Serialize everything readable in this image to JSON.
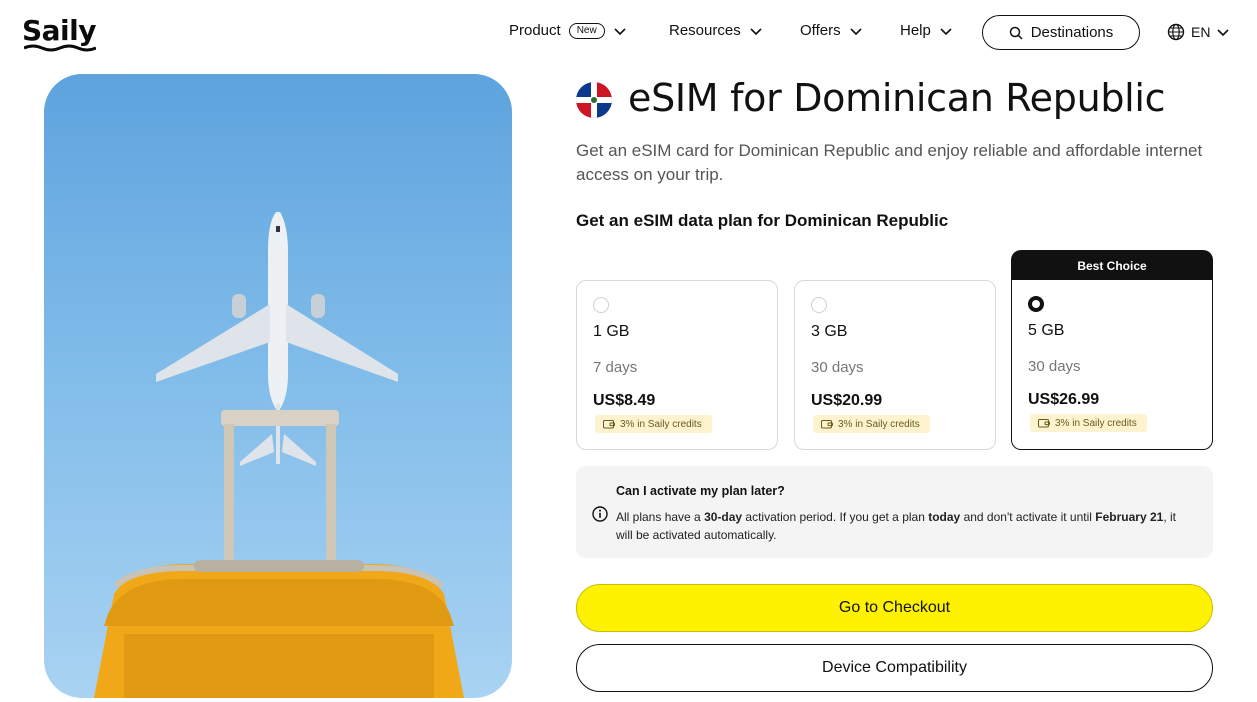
{
  "brand": {
    "logo_text": "Saily"
  },
  "nav": {
    "product": "Product",
    "product_badge": "New",
    "resources": "Resources",
    "offers": "Offers",
    "help": "Help",
    "destinations": "Destinations",
    "language": "EN"
  },
  "page": {
    "title": "eSIM for Dominican Republic",
    "subtitle": "Get an eSIM card for Dominican Republic and enjoy reliable and affordable internet access on your trip.",
    "plan_heading": "Get an eSIM data plan for Dominican Republic"
  },
  "plans": [
    {
      "data": "1 GB",
      "duration": "7 days",
      "price": "US$8.49",
      "credits": "3% in Saily credits",
      "selected": false
    },
    {
      "data": "3 GB",
      "duration": "30 days",
      "price": "US$20.99",
      "credits": "3% in Saily credits",
      "selected": false
    },
    {
      "data": "5 GB",
      "duration": "30 days",
      "price": "US$26.99",
      "credits": "3% in Saily credits",
      "selected": true,
      "badge": "Best Choice"
    }
  ],
  "faq": {
    "question": "Can I activate my plan later?",
    "answer_part1": "All plans have a ",
    "answer_bold1": "30-day",
    "answer_part2": " activation period. If you get a plan ",
    "answer_bold2": "today",
    "answer_part3": " and don't activate it until ",
    "answer_bold3": "February 21",
    "answer_part4": ", it will be activated automatically."
  },
  "buttons": {
    "checkout": "Go to Checkout",
    "compatibility": "Device Compatibility"
  },
  "colors": {
    "checkout_bg": "#fff200",
    "credits_bg": "#fdf3cf",
    "sky": "#5ea3de",
    "suitcase": "#f0a818",
    "flag_blue": "#0b3a8c",
    "flag_red": "#cf1426"
  },
  "icons": {
    "nav_chevron": "chevron-down-icon",
    "destinations": "search-icon",
    "language": "globe-icon",
    "credits": "wallet-icon",
    "faq": "info-icon",
    "flag": "dominican-republic-flag-icon"
  }
}
